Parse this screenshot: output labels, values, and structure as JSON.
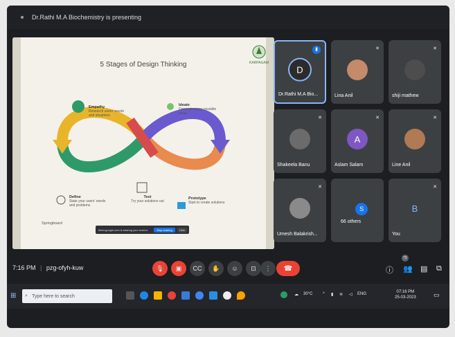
{
  "presenter_banner": "Dr.Rathi M.A Biochemistry is presenting",
  "slide": {
    "title": "5 Stages of Design Thinking",
    "stages": [
      {
        "name": "Empathy",
        "desc": "Research users' needs and situations"
      },
      {
        "name": "Ideate",
        "desc": "Generate many possible ideas"
      },
      {
        "name": "Define",
        "desc": "State your users' needs and problems"
      },
      {
        "name": "Test",
        "desc": "Try your solutions out"
      },
      {
        "name": "Prototype",
        "desc": "Start to create solutions"
      }
    ],
    "brand": "Springboard",
    "logo_text": "KARPAGAM",
    "notice": "Meet.google.com is sharing your screen.",
    "notice_stop": "Stop sharing",
    "notice_hide": "Hide"
  },
  "participants": [
    {
      "name": "Dr.Rathi M.A Bio...",
      "initial": "D",
      "color": "#3c4043"
    },
    {
      "name": "Lina Anil",
      "initial": "",
      "color": "#c58a6a"
    },
    {
      "name": "shiji mathew",
      "initial": "",
      "color": "#4d4d4d"
    },
    {
      "name": "Shakeela Banu",
      "initial": "",
      "color": "#6b6b6b"
    },
    {
      "name": "Aslam Salam",
      "initial": "A",
      "color": "#7e57c2"
    },
    {
      "name": "Line Anil",
      "initial": "",
      "color": "#b07a55"
    },
    {
      "name": "Umesh Balakrish...",
      "initial": "",
      "color": "#8a8a8a"
    },
    {
      "name": "66 others",
      "initial": "S",
      "color": "#1a73e8"
    },
    {
      "name": "You",
      "initial": "B",
      "color": "#3c4043"
    }
  ],
  "meeting": {
    "time": "7:16 PM",
    "separator": "|",
    "code": "pzg-ofyh-kuw",
    "people_badge": "75"
  },
  "icons": {
    "mic_off": "mic-off-icon",
    "cam_off": "camera-off-icon",
    "captions": "captions-icon",
    "raise_hand": "hand-icon",
    "emoji": "emoji-icon",
    "present": "present-icon",
    "more": "more-icon",
    "end": "end-call-icon",
    "info": "info-icon",
    "people": "people-icon",
    "chat": "chat-icon",
    "activities": "activities-icon"
  },
  "taskbar": {
    "search_placeholder": "Type here to search",
    "weather": "30°C",
    "lang": "ENG",
    "clock_time": "07:16 PM",
    "clock_date": "25-03-2023"
  },
  "colors": {
    "accent": "#8ab4f8",
    "danger": "#ea4335",
    "yellow": "#e8b42a",
    "green": "#2e9a6a",
    "purple": "#6a5acd",
    "orange": "#e98a4f",
    "red": "#d64b4b"
  }
}
